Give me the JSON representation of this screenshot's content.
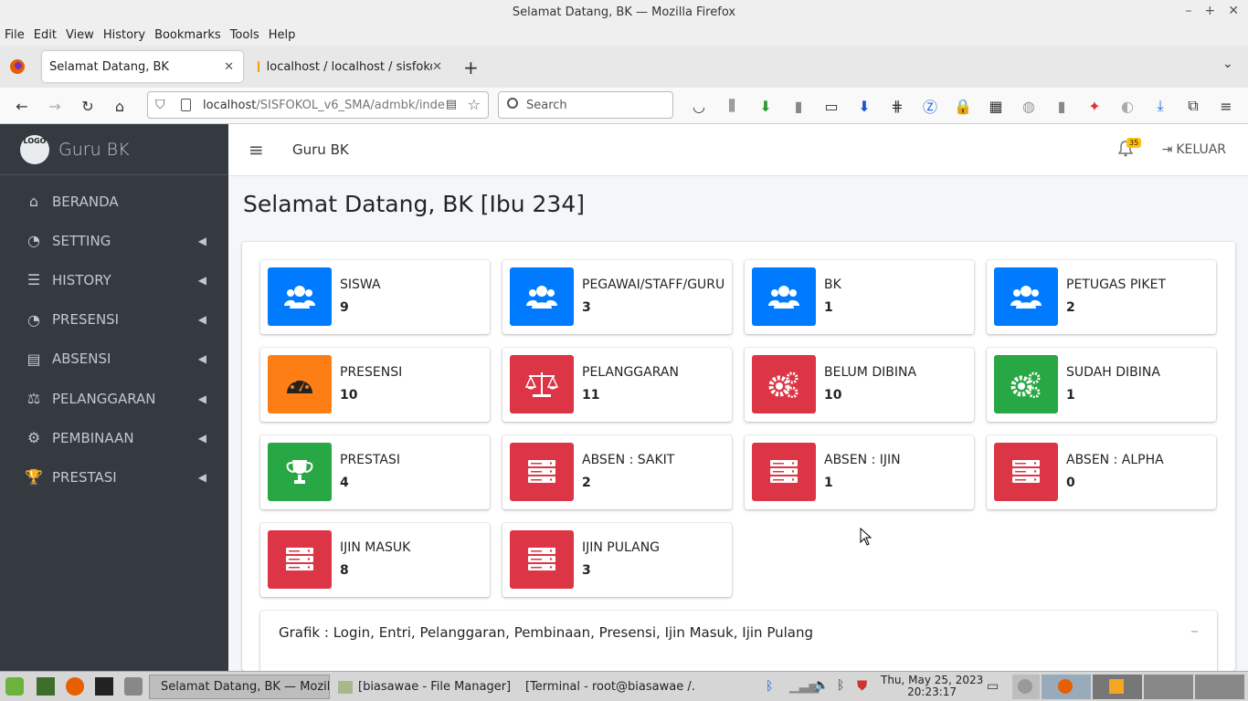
{
  "window": {
    "title": "Selamat Datang, BK — Mozilla Firefox"
  },
  "menu": [
    "File",
    "Edit",
    "View",
    "History",
    "Bookmarks",
    "Tools",
    "Help"
  ],
  "tabs": [
    {
      "label": "Selamat Datang, BK"
    },
    {
      "label": "localhost / localhost / sisfokol"
    }
  ],
  "url": {
    "host": "localhost",
    "path": "/SISFOKOL_v6_SMA/admbk/inde"
  },
  "search": {
    "placeholder": "Search"
  },
  "sidebar": {
    "brand": "Guru BK",
    "logo_text": "LOGO",
    "items": [
      {
        "label": "BERANDA",
        "icon": "home-icon",
        "glyph": "⌂",
        "chevron": false
      },
      {
        "label": "SETTING",
        "icon": "tachometer-icon",
        "glyph": "◔",
        "chevron": true
      },
      {
        "label": "HISTORY",
        "icon": "server-icon",
        "glyph": "☰",
        "chevron": true
      },
      {
        "label": "PRESENSI",
        "icon": "tachometer-icon",
        "glyph": "◔",
        "chevron": true
      },
      {
        "label": "ABSENSI",
        "icon": "newspaper-icon",
        "glyph": "▤",
        "chevron": true
      },
      {
        "label": "PELANGGARAN",
        "icon": "balance-scale-icon",
        "glyph": "⚖",
        "chevron": true
      },
      {
        "label": "PEMBINAAN",
        "icon": "cogs-icon",
        "glyph": "⚙",
        "chevron": true
      },
      {
        "label": "PRESTASI",
        "icon": "trophy-icon",
        "glyph": "🏆",
        "chevron": true
      }
    ]
  },
  "topnav": {
    "title": "Guru BK",
    "notif_count": "35",
    "logout": "KELUAR"
  },
  "page": {
    "heading": "Selamat Datang, BK [Ibu 234]"
  },
  "colors": {
    "blue": "#007bff",
    "orange": "#fd7e14",
    "red": "#dc3545",
    "green": "#28a745"
  },
  "stats": [
    {
      "label": "SISWA",
      "value": "9",
      "icon": "users-icon",
      "color": "#007bff"
    },
    {
      "label": "PEGAWAI/STAFF/GURU",
      "value": "3",
      "icon": "users-icon",
      "color": "#007bff"
    },
    {
      "label": "BK",
      "value": "1",
      "icon": "users-icon",
      "color": "#007bff"
    },
    {
      "label": "PETUGAS PIKET",
      "value": "2",
      "icon": "users-icon",
      "color": "#007bff"
    },
    {
      "label": "PRESENSI",
      "value": "10",
      "icon": "tachometer-icon",
      "color": "#fd7e14"
    },
    {
      "label": "PELANGGARAN",
      "value": "11",
      "icon": "balance-scale-icon",
      "color": "#dc3545"
    },
    {
      "label": "BELUM DIBINA",
      "value": "10",
      "icon": "cogs-icon",
      "color": "#dc3545"
    },
    {
      "label": "SUDAH DIBINA",
      "value": "1",
      "icon": "cogs-icon",
      "color": "#28a745"
    },
    {
      "label": "PRESTASI",
      "value": "4",
      "icon": "trophy-icon",
      "color": "#28a745"
    },
    {
      "label": "ABSEN : SAKIT",
      "value": "2",
      "icon": "server-icon",
      "color": "#dc3545"
    },
    {
      "label": "ABSEN : IJIN",
      "value": "1",
      "icon": "server-icon",
      "color": "#dc3545"
    },
    {
      "label": "ABSEN : ALPHA",
      "value": "0",
      "icon": "server-icon",
      "color": "#dc3545"
    },
    {
      "label": "IJIN MASUK",
      "value": "8",
      "icon": "server-icon",
      "color": "#dc3545"
    },
    {
      "label": "IJIN PULANG",
      "value": "3",
      "icon": "server-icon",
      "color": "#dc3545"
    }
  ],
  "grafik": {
    "title": "Grafik : Login, Entri, Pelanggaran, Pembinaan, Presensi, Ijin Masuk, Ijin Pulang"
  },
  "taskbar": {
    "apps": [
      {
        "label": "Selamat Datang, BK — Mozil..."
      },
      {
        "label": "[biasawae - File Manager]"
      },
      {
        "label": "[Terminal - root@biasawae /..."
      }
    ],
    "date": "Thu, May 25, 2023",
    "time": "20:23:17"
  }
}
